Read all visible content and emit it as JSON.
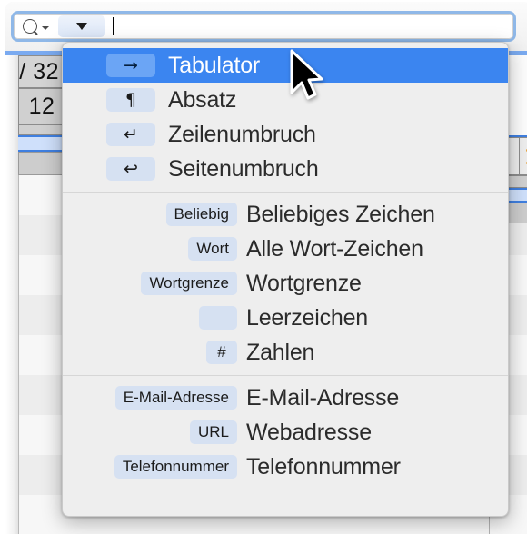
{
  "search": {
    "magnifier_icon": "search-icon",
    "magnifier_chevron_icon": "chevron-down-small-icon",
    "dropdown_button_icon": "chevron-down-icon",
    "value": "",
    "placeholder": ""
  },
  "background": {
    "header_cells": [
      "/ 32",
      "12"
    ]
  },
  "menu": {
    "groups": [
      {
        "name": "special-characters",
        "items": [
          {
            "chip": "→",
            "chip_kind": "glyph",
            "icon_name": "tab-arrow-icon",
            "label": "Tabulator",
            "selected": true
          },
          {
            "chip": "¶",
            "chip_kind": "glyph",
            "icon_name": "pilcrow-icon",
            "label": "Absatz",
            "selected": false
          },
          {
            "chip": "↵",
            "chip_kind": "glyph",
            "icon_name": "line-break-icon",
            "label": "Zeilenumbruch",
            "selected": false
          },
          {
            "chip": "↩",
            "chip_kind": "glyph",
            "icon_name": "page-break-icon",
            "label": "Seitenumbruch",
            "selected": false
          }
        ]
      },
      {
        "name": "character-classes",
        "items": [
          {
            "chip": "Beliebig",
            "chip_kind": "text",
            "icon_name": "any-character-token",
            "label": "Beliebiges Zeichen",
            "selected": false
          },
          {
            "chip": "Wort",
            "chip_kind": "text",
            "icon_name": "word-character-token",
            "label": "Alle Wort-Zeichen",
            "selected": false
          },
          {
            "chip": "Wortgrenze",
            "chip_kind": "text",
            "icon_name": "word-boundary-token",
            "label": "Wortgrenze",
            "selected": false
          },
          {
            "chip": "",
            "chip_kind": "empty",
            "icon_name": "whitespace-token",
            "label": "Leerzeichen",
            "selected": false
          },
          {
            "chip": "#",
            "chip_kind": "text",
            "icon_name": "digits-token",
            "label": "Zahlen",
            "selected": false
          }
        ]
      },
      {
        "name": "patterns",
        "items": [
          {
            "chip": "E-Mail-Adresse",
            "chip_kind": "text",
            "icon_name": "email-token",
            "label": "E-Mail-Adresse",
            "selected": false
          },
          {
            "chip": "URL",
            "chip_kind": "text",
            "icon_name": "url-token",
            "label": "Webadresse",
            "selected": false
          },
          {
            "chip": "Telefonnummer",
            "chip_kind": "text",
            "icon_name": "phone-token",
            "label": "Telefonnummer",
            "selected": false
          }
        ]
      }
    ]
  },
  "colors": {
    "selection_blue": "#3b85f0",
    "chip_blue": "#d6e1f2",
    "chip_blue_selected": "#6ba5f5",
    "menu_background": "#eeeeee",
    "focus_ring": "#8fb8e8"
  }
}
